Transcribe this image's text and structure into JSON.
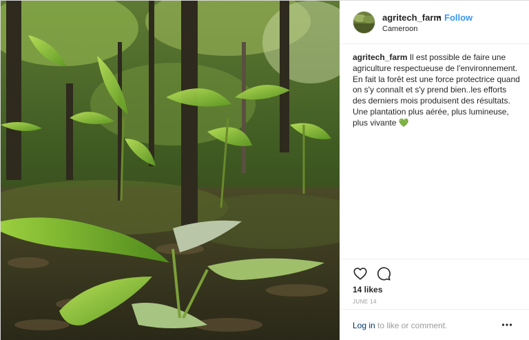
{
  "post": {
    "photo_icon": "forest-photo",
    "header": {
      "username": "agritech_farm",
      "separator": "•",
      "follow_label": "Follow",
      "location": "Cameroon",
      "avatar_icon": "avatar"
    },
    "caption": {
      "username": "agritech_farm",
      "text": "Il est possible de faire une agriculture respectueuse de l'environnement. En fait la forêt est une force protectrice quand on s'y connaît et s'y prend bien..les efforts des derniers mois produisent des résultats. Une plantation plus aérée, plus lumineuse, plus vivante",
      "emoji": "💚"
    },
    "actions": {
      "like_icon": "heart-outline-icon",
      "comment_icon": "comment-bubble-icon",
      "likes": "14 likes",
      "date": "JUNE 14"
    },
    "footer": {
      "login_label": "Log in",
      "login_rest": "to like or comment.",
      "more_icon": "more-options-icon"
    }
  },
  "colors": {
    "accent": "#3897f0",
    "link": "#003569",
    "muted": "#999999",
    "text": "#262626",
    "border": "#dbdbdb"
  }
}
